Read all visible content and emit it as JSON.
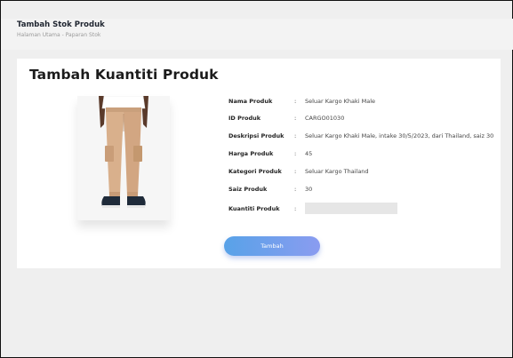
{
  "header": {
    "title": "Tambah Stok Produk",
    "breadcrumb": "Halaman Utama - Paparan Stok"
  },
  "card": {
    "title": "Tambah Kuantiti Produk"
  },
  "product": {
    "rows": [
      {
        "label": "Nama Produk",
        "colon": ":",
        "value": "Seluar Kargo Khaki Male"
      },
      {
        "label": "ID Produk",
        "colon": ":",
        "value": "CARGO01030"
      },
      {
        "label": "Deskripsi Produk",
        "colon": ":",
        "value": "Seluar Kargo Khaki Male, intake 30/5/2023, dari Thailand, saiz 30"
      },
      {
        "label": "Harga Produk",
        "colon": ":",
        "value": "45"
      },
      {
        "label": "Kategori Produk",
        "colon": ":",
        "value": "Seluar Kargo Thailand"
      },
      {
        "label": "Saiz Produk",
        "colon": ":",
        "value": "30"
      }
    ],
    "quantity": {
      "label": "Kuantiti Produk",
      "colon": ":",
      "value": "",
      "placeholder": ""
    }
  },
  "actions": {
    "submit_label": "Tambah"
  },
  "colors": {
    "button_gradient_start": "#58a2e8",
    "button_gradient_end": "#8a9cf0",
    "pants": "#d9b08c",
    "shirt": "#ffffff",
    "shoes": "#1f2b3a"
  },
  "icons": {
    "product_image": "khaki-cargo-pants-photo"
  }
}
